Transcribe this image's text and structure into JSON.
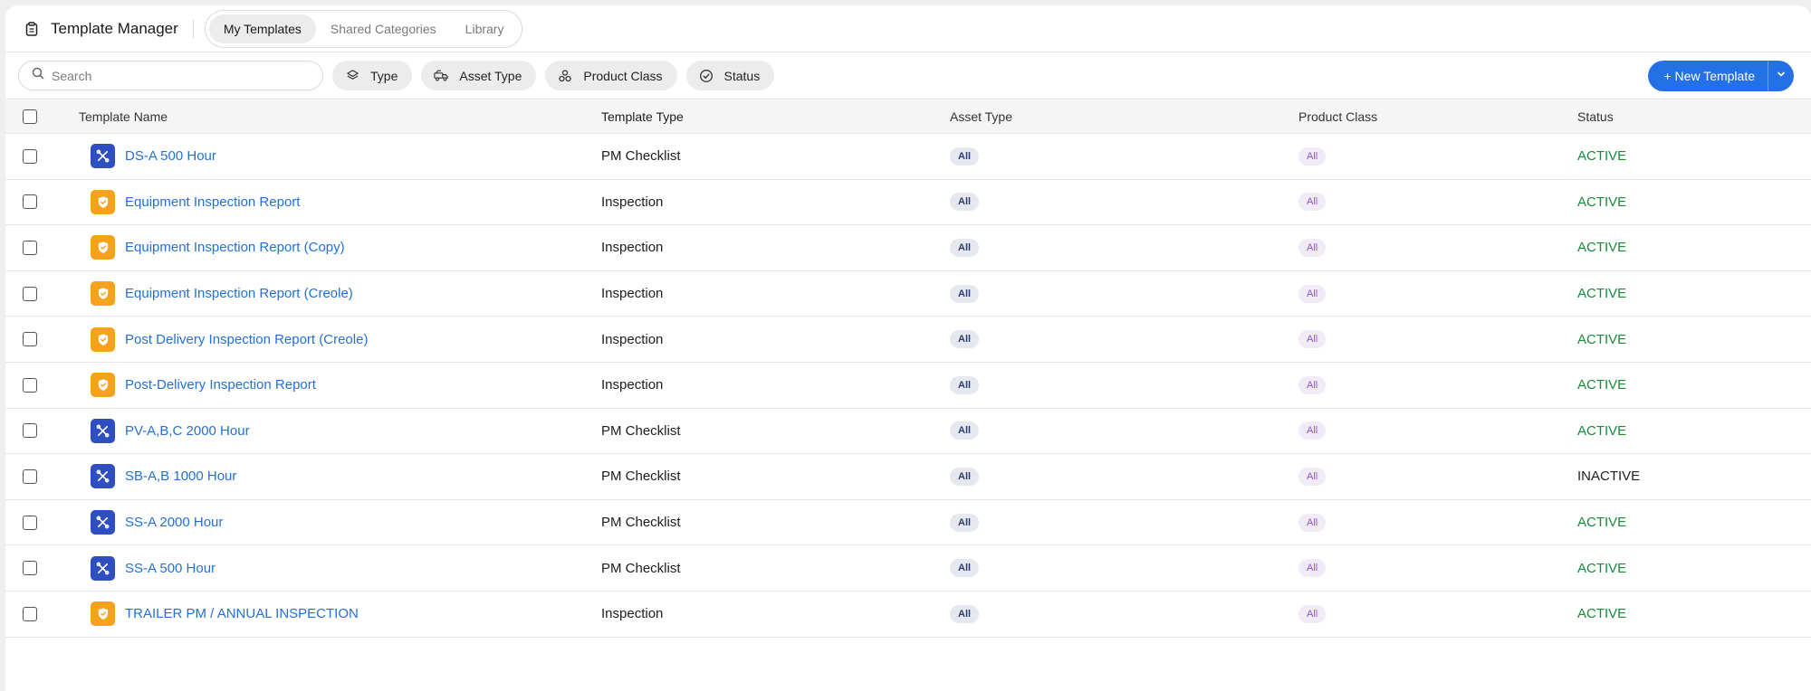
{
  "header": {
    "app_title": "Template Manager",
    "tabs": [
      {
        "label": "My Templates",
        "active": true
      },
      {
        "label": "Shared Categories",
        "active": false
      },
      {
        "label": "Library",
        "active": false
      }
    ]
  },
  "toolbar": {
    "search_placeholder": "Search",
    "filters": [
      {
        "label": "Type",
        "icon": "layers-icon"
      },
      {
        "label": "Asset Type",
        "icon": "truck-icon"
      },
      {
        "label": "Product Class",
        "icon": "cubes-icon"
      },
      {
        "label": "Status",
        "icon": "check-circle-icon"
      }
    ],
    "new_button_label": "+ New Template"
  },
  "table": {
    "columns": [
      "Template Name",
      "Template Type",
      "Asset Type",
      "Product Class",
      "Status"
    ],
    "rows": [
      {
        "name": "DS-A 500 Hour",
        "kind": "pm",
        "type": "PM Checklist",
        "asset": "All",
        "class": "All",
        "status": "ACTIVE"
      },
      {
        "name": "Equipment Inspection Report",
        "kind": "insp",
        "type": "Inspection",
        "asset": "All",
        "class": "All",
        "status": "ACTIVE"
      },
      {
        "name": "Equipment Inspection Report (Copy)",
        "kind": "insp",
        "type": "Inspection",
        "asset": "All",
        "class": "All",
        "status": "ACTIVE"
      },
      {
        "name": "Equipment Inspection Report (Creole)",
        "kind": "insp",
        "type": "Inspection",
        "asset": "All",
        "class": "All",
        "status": "ACTIVE"
      },
      {
        "name": "Post Delivery Inspection Report (Creole)",
        "kind": "insp",
        "type": "Inspection",
        "asset": "All",
        "class": "All",
        "status": "ACTIVE"
      },
      {
        "name": "Post-Delivery Inspection Report",
        "kind": "insp",
        "type": "Inspection",
        "asset": "All",
        "class": "All",
        "status": "ACTIVE"
      },
      {
        "name": "PV-A,B,C 2000 Hour",
        "kind": "pm",
        "type": "PM Checklist",
        "asset": "All",
        "class": "All",
        "status": "ACTIVE"
      },
      {
        "name": "SB-A,B 1000 Hour",
        "kind": "pm",
        "type": "PM Checklist",
        "asset": "All",
        "class": "All",
        "status": "INACTIVE"
      },
      {
        "name": "SS-A 2000 Hour",
        "kind": "pm",
        "type": "PM Checklist",
        "asset": "All",
        "class": "All",
        "status": "ACTIVE"
      },
      {
        "name": "SS-A 500 Hour",
        "kind": "pm",
        "type": "PM Checklist",
        "asset": "All",
        "class": "All",
        "status": "ACTIVE"
      },
      {
        "name": "TRAILER PM / ANNUAL INSPECTION",
        "kind": "insp",
        "type": "Inspection",
        "asset": "All",
        "class": "All",
        "status": "ACTIVE"
      }
    ]
  },
  "colors": {
    "accent": "#2470e6",
    "pm_icon": "#2f4ec0",
    "inspection_icon": "#f6a21a",
    "active_status": "#1a8a3a"
  }
}
